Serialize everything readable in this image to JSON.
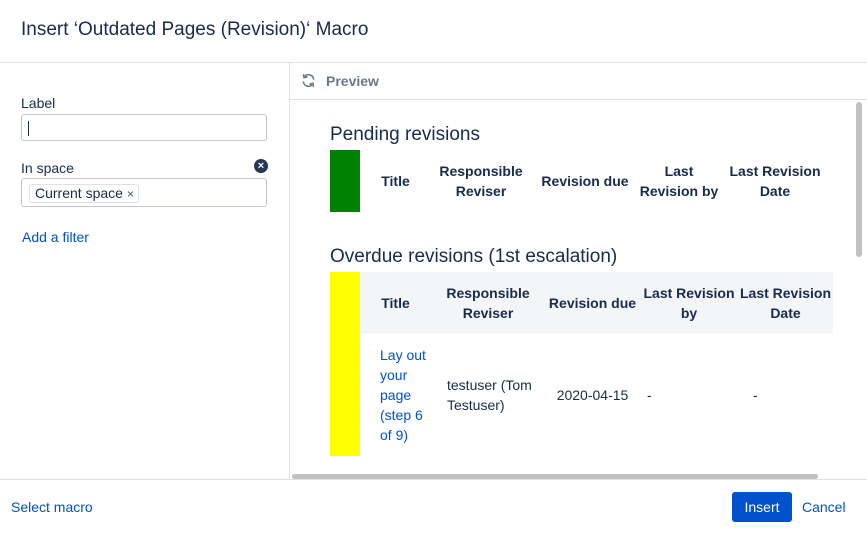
{
  "dialog": {
    "title": "Insert ‘Outdated Pages (Revision)‘ Macro"
  },
  "params": {
    "label": {
      "label": "Label",
      "value": ""
    },
    "space": {
      "label": "In space",
      "tag": "Current space",
      "tag_remove": "×",
      "clear": "×"
    },
    "add_filter": "Add a filter"
  },
  "preview": {
    "label": "Preview",
    "sections": [
      {
        "title": "Pending revisions",
        "bar_color": "#008000",
        "headers": [
          "Title",
          "Responsible Reviser",
          "Revision due",
          "Last Revision by",
          "Last Revision Date"
        ],
        "rows": []
      },
      {
        "title": "Overdue revisions (1st escalation)",
        "bar_color": "#ffff00",
        "headers": [
          "Title",
          "Responsible Reviser",
          "Revision due",
          "Last Revision by",
          "Last Revision Date"
        ],
        "rows": [
          [
            "Lay out your page (step 6 of 9)",
            "testuser (Tom Testuser)",
            "2020-04-15",
            "-",
            "-"
          ]
        ]
      }
    ]
  },
  "footer": {
    "select_macro": "Select macro",
    "insert": "Insert",
    "cancel": "Cancel"
  },
  "icons": {
    "refresh": "refresh-icon",
    "clear": "clear-icon",
    "remove": "remove-tag-icon"
  }
}
